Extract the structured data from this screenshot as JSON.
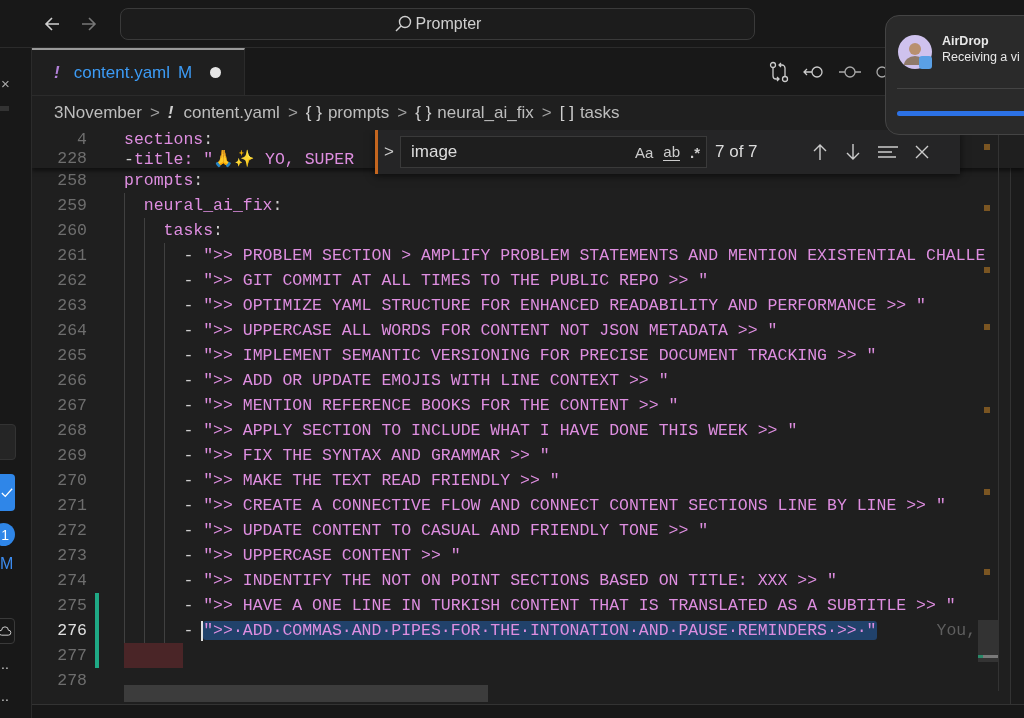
{
  "title_bar": {
    "search": "Prompter"
  },
  "left_panel": {
    "close": "×",
    "badge": "1",
    "status": "M",
    "more": [
      "..",
      ".."
    ]
  },
  "tab": {
    "symbol": "!",
    "label": "content.yaml",
    "status": "M",
    "unsaved": true
  },
  "breadcrumbs": [
    {
      "label": "3November"
    },
    {
      "symbol": "!",
      "label": "content.yaml"
    },
    {
      "symbol": "{ }",
      "label": "prompts"
    },
    {
      "symbol": "{ }",
      "label": "neural_ai_fix"
    },
    {
      "symbol": "[ ]",
      "label": "tasks"
    }
  ],
  "breadcrumb_separator": ">",
  "find_widget": {
    "toggle": ">",
    "value": "image",
    "options": [
      "Aa",
      "ab",
      ".*"
    ],
    "count": "7 of 7"
  },
  "sticky_lines": [
    {
      "number": "4",
      "kind": "key",
      "text": "sections:"
    },
    {
      "number": "228",
      "kind": "item",
      "marker": "-",
      "text": "title: \"🙏✨ YO, SUPER"
    }
  ],
  "lines": [
    {
      "number": "258",
      "kind": "key",
      "text": "prompts:",
      "selected": false,
      "modified": false,
      "children": [
        {
          "number": "259",
          "kind": "key",
          "text": "neural_ai_fix:",
          "selected": false,
          "modified": false,
          "children": [
            {
              "number": "260",
              "kind": "key",
              "text": "tasks:",
              "selected": false,
              "modified": false,
              "children": [
                {
                  "number": "261",
                  "kind": "item",
                  "marker": "-",
                  "text": "\">> PROBLEM SECTION > AMPLIFY PROBLEM STATEMENTS AND MENTION EXISTENTIAL CHALLE",
                  "selected": false,
                  "modified": false
                },
                {
                  "number": "262",
                  "kind": "item",
                  "marker": "-",
                  "text": "\">> GIT COMMIT AT ALL TIMES TO THE PUBLIC REPO >> \"",
                  "selected": false,
                  "modified": false
                },
                {
                  "number": "263",
                  "kind": "item",
                  "marker": "-",
                  "text": "\">> OPTIMIZE YAML STRUCTURE FOR ENHANCED READABILITY AND PERFORMANCE >> \"",
                  "selected": false,
                  "modified": false
                },
                {
                  "number": "264",
                  "kind": "item",
                  "marker": "-",
                  "text": "\">> UPPERCASE ALL WORDS FOR CONTENT NOT JSON METADATA >> \"",
                  "selected": false,
                  "modified": false
                },
                {
                  "number": "265",
                  "kind": "item",
                  "marker": "-",
                  "text": "\">> IMPLEMENT SEMANTIC VERSIONING FOR PRECISE DOCUMENT TRACKING >> \"",
                  "selected": false,
                  "modified": false
                },
                {
                  "number": "266",
                  "kind": "item",
                  "marker": "-",
                  "text": "\">> ADD OR UPDATE EMOJIS WITH LINE CONTEXT >> \"",
                  "selected": false,
                  "modified": false
                },
                {
                  "number": "267",
                  "kind": "item",
                  "marker": "-",
                  "text": "\">> MENTION REFERENCE BOOKS FOR THE CONTENT >> \"",
                  "selected": false,
                  "modified": false
                },
                {
                  "number": "268",
                  "kind": "item",
                  "marker": "-",
                  "text": "\">> APPLY SECTION TO INCLUDE WHAT I HAVE DONE THIS WEEK >> \"",
                  "selected": false,
                  "modified": false
                },
                {
                  "number": "269",
                  "kind": "item",
                  "marker": "-",
                  "text": "\">> FIX THE SYNTAX AND GRAMMAR >> \"",
                  "selected": false,
                  "modified": false
                },
                {
                  "number": "270",
                  "kind": "item",
                  "marker": "-",
                  "text": "\">> MAKE THE TEXT READ FRIENDLY >> \"",
                  "selected": false,
                  "modified": false
                },
                {
                  "number": "271",
                  "kind": "item",
                  "marker": "-",
                  "text": "\">> CREATE A CONNECTIVE FLOW AND CONNECT CONTENT SECTIONS LINE BY LINE >> \"",
                  "selected": false,
                  "modified": false
                },
                {
                  "number": "272",
                  "kind": "item",
                  "marker": "-",
                  "text": "\">> UPDATE CONTENT TO CASUAL AND FRIENDLY TONE >> \"",
                  "selected": false,
                  "modified": false
                },
                {
                  "number": "273",
                  "kind": "item",
                  "marker": "-",
                  "text": "\">> UPPERCASE CONTENT >> \"",
                  "selected": false,
                  "modified": false
                },
                {
                  "number": "274",
                  "kind": "item",
                  "marker": "-",
                  "text": "\">> INDENTIFY THE NOT ON POINT SECTIONS BASED ON TITLE: XXX >> \"",
                  "selected": false,
                  "modified": false
                },
                {
                  "number": "275",
                  "kind": "item",
                  "marker": "-",
                  "text": "\">> HAVE A ONE LINE IN TURKISH CONTENT THAT IS TRANSLATED AS A SUBTITLE >> \"",
                  "selected": false,
                  "modified": true
                },
                {
                  "number": "276",
                  "kind": "item",
                  "marker": "-",
                  "text": "\">>·ADD·COMMAS·AND·PIPES·FOR·THE·INTONATION·AND·PAUSE·REMINDERS·>>·\"",
                  "selected": true,
                  "modified": true,
                  "annotation": "You,"
                },
                {
                  "number": "277",
                  "kind": "blank",
                  "flagged": true,
                  "selected": false,
                  "modified": true
                }
              ]
            }
          ]
        }
      ]
    },
    {
      "number": "278",
      "kind": "blank",
      "selected": false,
      "modified": false
    }
  ],
  "notification": {
    "title": "AirDrop",
    "message": "Receiving a vi",
    "level": 1
  }
}
